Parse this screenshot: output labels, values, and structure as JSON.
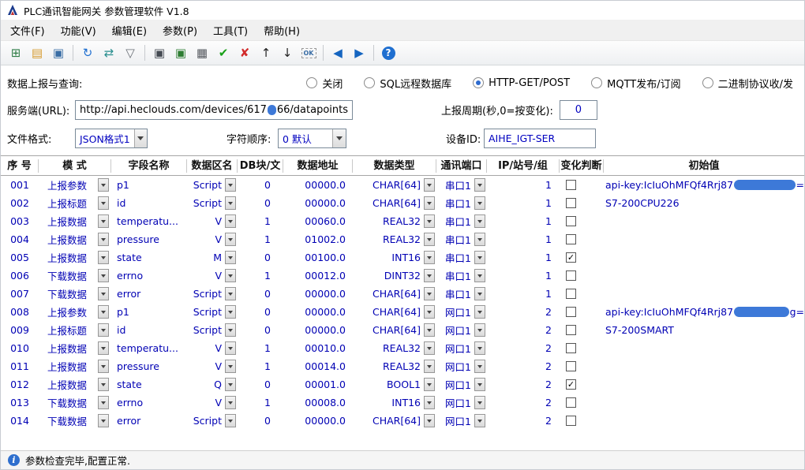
{
  "window": {
    "title": "PLC通讯智能网关 参数管理软件 V1.8"
  },
  "menu": {
    "items": [
      {
        "id": "file",
        "label": "文件(F)"
      },
      {
        "id": "function",
        "label": "功能(V)"
      },
      {
        "id": "edit",
        "label": "编辑(E)"
      },
      {
        "id": "param",
        "label": "参数(P)"
      },
      {
        "id": "tools",
        "label": "工具(T)"
      },
      {
        "id": "help",
        "label": "帮助(H)"
      }
    ]
  },
  "toolbar": {
    "items": [
      "grid-connect-icon",
      "open-folder-icon",
      "save-icon",
      "separator",
      "refresh-icon",
      "transfer-icon",
      "filter-download-icon",
      "separator",
      "monitor-icon",
      "web-monitor-icon",
      "keypad-icon",
      "check-icon",
      "cancel-icon",
      "move-up-icon",
      "move-down-icon",
      "ok-box-icon",
      "separator",
      "prev-icon",
      "next-icon",
      "separator",
      "help-icon"
    ]
  },
  "report": {
    "label": "数据上报与查询:",
    "options": [
      {
        "id": "close",
        "label": "关闭",
        "selected": false
      },
      {
        "id": "sql",
        "label": "SQL远程数据库",
        "selected": false
      },
      {
        "id": "http",
        "label": "HTTP-GET/POST",
        "selected": true
      },
      {
        "id": "mqtt",
        "label": "MQTT发布/订阅",
        "selected": false
      },
      {
        "id": "binary",
        "label": "二进制协议收/发",
        "selected": false
      }
    ]
  },
  "server": {
    "url_label": "服务端(URL):",
    "url_prefix": "http://api.heclouds.com/devices/617",
    "url_redacted": true,
    "url_suffix": "66/datapoints",
    "period_label": "上报周期(秒,0=按变化):",
    "period_value": "0"
  },
  "format": {
    "file_label": "文件格式:",
    "file_value": "JSON格式1",
    "order_label": "字符顺序:",
    "order_value": "0 默认",
    "device_label": "设备ID:",
    "device_value": "AIHE_IGT-SER"
  },
  "table": {
    "headers": [
      "序 号",
      "模 式",
      "字段名称",
      "数据区名",
      "DB块/文",
      "数据地址",
      "数据类型",
      "通讯端口",
      "IP/站号/组",
      "变化判断",
      "初始值"
    ],
    "rows": [
      {
        "no": "001",
        "mode": "上报参数",
        "field": "p1",
        "area": "Script",
        "db": "0",
        "addr": "00000.0",
        "type": "CHAR[64]",
        "port": "串口1",
        "station": "1",
        "changed": false,
        "init_prefix": "api-key:IcIuOhMFQf4Rrj87",
        "init_redacted": true,
        "init_suffix": "="
      },
      {
        "no": "002",
        "mode": "上报标题",
        "field": "id",
        "area": "Script",
        "db": "0",
        "addr": "00000.0",
        "type": "CHAR[64]",
        "port": "串口1",
        "station": "1",
        "changed": false,
        "init_prefix": "S7-200CPU226",
        "init_redacted": false,
        "init_suffix": ""
      },
      {
        "no": "003",
        "mode": "上报数据",
        "field": "temperatu...",
        "area": "V",
        "db": "1",
        "addr": "00060.0",
        "type": "REAL32",
        "port": "串口1",
        "station": "1",
        "changed": false,
        "init_prefix": "",
        "init_redacted": false,
        "init_suffix": ""
      },
      {
        "no": "004",
        "mode": "上报数据",
        "field": "pressure",
        "area": "V",
        "db": "1",
        "addr": "01002.0",
        "type": "REAL32",
        "port": "串口1",
        "station": "1",
        "changed": false,
        "init_prefix": "",
        "init_redacted": false,
        "init_suffix": ""
      },
      {
        "no": "005",
        "mode": "上报数据",
        "field": "state",
        "area": "M",
        "db": "0",
        "addr": "00100.0",
        "type": "INT16",
        "port": "串口1",
        "station": "1",
        "changed": true,
        "init_prefix": "",
        "init_redacted": false,
        "init_suffix": ""
      },
      {
        "no": "006",
        "mode": "下载数据",
        "field": "errno",
        "area": "V",
        "db": "1",
        "addr": "00012.0",
        "type": "DINT32",
        "port": "串口1",
        "station": "1",
        "changed": false,
        "init_prefix": "",
        "init_redacted": false,
        "init_suffix": ""
      },
      {
        "no": "007",
        "mode": "下载数据",
        "field": "error",
        "area": "Script",
        "db": "0",
        "addr": "00000.0",
        "type": "CHAR[64]",
        "port": "串口1",
        "station": "1",
        "changed": false,
        "init_prefix": "",
        "init_redacted": false,
        "init_suffix": ""
      },
      {
        "no": "008",
        "mode": "上报参数",
        "field": "p1",
        "area": "Script",
        "db": "0",
        "addr": "00000.0",
        "type": "CHAR[64]",
        "port": "网口1",
        "station": "2",
        "changed": false,
        "init_prefix": "api-key:IcIuOhMFQf4Rrj87",
        "init_redacted": true,
        "init_suffix": "g="
      },
      {
        "no": "009",
        "mode": "上报标题",
        "field": "id",
        "area": "Script",
        "db": "0",
        "addr": "00000.0",
        "type": "CHAR[64]",
        "port": "网口1",
        "station": "2",
        "changed": false,
        "init_prefix": "S7-200SMART",
        "init_redacted": false,
        "init_suffix": ""
      },
      {
        "no": "010",
        "mode": "上报数据",
        "field": "temperatu...",
        "area": "V",
        "db": "1",
        "addr": "00010.0",
        "type": "REAL32",
        "port": "网口1",
        "station": "2",
        "changed": false,
        "init_prefix": "",
        "init_redacted": false,
        "init_suffix": ""
      },
      {
        "no": "011",
        "mode": "上报数据",
        "field": "pressure",
        "area": "V",
        "db": "1",
        "addr": "00014.0",
        "type": "REAL32",
        "port": "网口1",
        "station": "2",
        "changed": false,
        "init_prefix": "",
        "init_redacted": false,
        "init_suffix": ""
      },
      {
        "no": "012",
        "mode": "上报数据",
        "field": "state",
        "area": "Q",
        "db": "0",
        "addr": "00001.0",
        "type": "BOOL1",
        "port": "网口1",
        "station": "2",
        "changed": true,
        "init_prefix": "",
        "init_redacted": false,
        "init_suffix": ""
      },
      {
        "no": "013",
        "mode": "下载数据",
        "field": "errno",
        "area": "V",
        "db": "1",
        "addr": "00008.0",
        "type": "INT16",
        "port": "网口1",
        "station": "2",
        "changed": false,
        "init_prefix": "",
        "init_redacted": false,
        "init_suffix": ""
      },
      {
        "no": "014",
        "mode": "下载数据",
        "field": "error",
        "area": "Script",
        "db": "0",
        "addr": "00000.0",
        "type": "CHAR[64]",
        "port": "网口1",
        "station": "2",
        "changed": false,
        "init_prefix": "",
        "init_redacted": false,
        "init_suffix": ""
      }
    ]
  },
  "statusbar": {
    "text": "参数检查完毕,配置正常."
  }
}
